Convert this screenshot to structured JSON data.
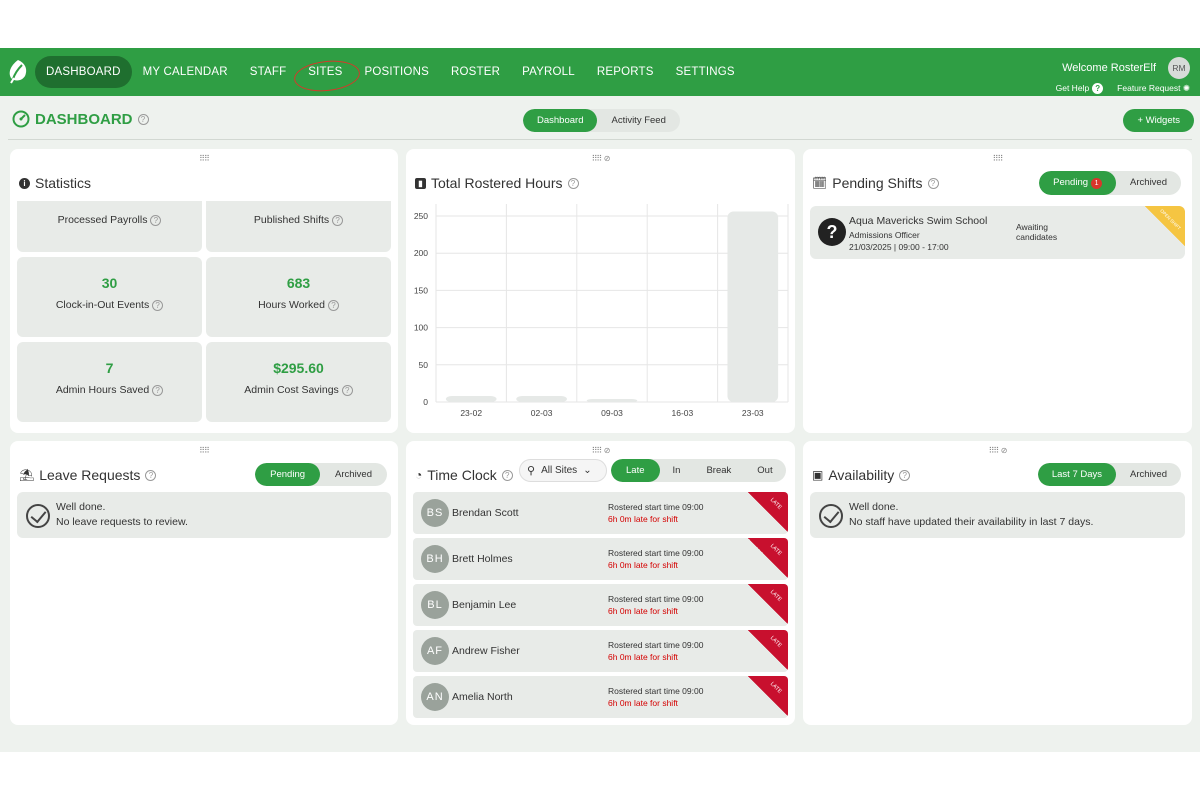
{
  "nav": {
    "items": [
      {
        "label": "DASHBOARD",
        "active": true
      },
      {
        "label": "MY CALENDAR"
      },
      {
        "label": "STAFF"
      },
      {
        "label": "SITES",
        "circled": true
      },
      {
        "label": "POSITIONS"
      },
      {
        "label": "ROSTER"
      },
      {
        "label": "PAYROLL"
      },
      {
        "label": "REPORTS"
      },
      {
        "label": "SETTINGS"
      }
    ],
    "welcome": "Welcome RosterElf",
    "avatar": "RM",
    "get_help": "Get Help",
    "feature_request": "Feature Request"
  },
  "header": {
    "title": "DASHBOARD",
    "tabs": [
      "Dashboard",
      "Activity Feed"
    ],
    "widgets_button": "+ Widgets"
  },
  "statistics": {
    "title": "Statistics",
    "boxes": [
      {
        "value": "",
        "label": "Processed Payrolls"
      },
      {
        "value": "",
        "label": "Published Shifts"
      },
      {
        "value": "30",
        "label": "Clock-in-Out Events"
      },
      {
        "value": "683",
        "label": "Hours Worked"
      },
      {
        "value": "7",
        "label": "Admin Hours Saved"
      },
      {
        "value": "$295.60",
        "label": "Admin Cost Savings"
      }
    ]
  },
  "rostered_hours": {
    "title": "Total Rostered Hours"
  },
  "chart_data": {
    "type": "bar",
    "categories": [
      "23-02",
      "02-03",
      "09-03",
      "16-03",
      "23-03"
    ],
    "values": [
      8,
      8,
      4,
      0,
      256
    ],
    "ylim": [
      0,
      250
    ],
    "yticks": [
      "0",
      "50",
      "100",
      "150",
      "200",
      "250"
    ],
    "grid": true
  },
  "pending_shifts": {
    "title": "Pending Shifts",
    "tabs": [
      "Pending",
      "Archived"
    ],
    "count": "1",
    "shift": {
      "org": "Aqua Mavericks Swim School",
      "position": "Admissions Officer",
      "when": "21/03/2025 | 09:00 - 17:00",
      "status_line1": "Awaiting",
      "status_line2": "candidates",
      "ribbon": "OPEN SHIFT"
    }
  },
  "leave_requests": {
    "title": "Leave Requests",
    "tabs": [
      "Pending",
      "Archived"
    ],
    "msg1": "Well done.",
    "msg2": "No leave requests to review."
  },
  "time_clock": {
    "title": "Time Clock",
    "site_select": "All Sites",
    "tabs": [
      "Late",
      "In",
      "Break",
      "Out"
    ],
    "rows": [
      {
        "initials": "BS",
        "name": "Brendan Scott",
        "line1": "Rostered start time 09:00",
        "line2": "6h 0m late for shift",
        "tag": "LATE"
      },
      {
        "initials": "BH",
        "name": "Brett Holmes",
        "line1": "Rostered start time 09:00",
        "line2": "6h 0m late for shift",
        "tag": "LATE"
      },
      {
        "initials": "BL",
        "name": "Benjamin Lee",
        "line1": "Rostered start time 09:00",
        "line2": "6h 0m late for shift",
        "tag": "LATE"
      },
      {
        "initials": "AF",
        "name": "Andrew Fisher",
        "line1": "Rostered start time 09:00",
        "line2": "6h 0m late for shift",
        "tag": "LATE"
      },
      {
        "initials": "AN",
        "name": "Amelia North",
        "line1": "Rostered start time 09:00",
        "line2": "6h 0m late for shift",
        "tag": "LATE"
      }
    ]
  },
  "availability": {
    "title": "Availability",
    "tabs": [
      "Last 7 Days",
      "Archived"
    ],
    "msg1": "Well done.",
    "msg2": "No staff have updated their availability in last 7 days."
  },
  "colors": {
    "brand": "#2f9e44",
    "late": "#c8102e",
    "alert": "#d40000"
  }
}
